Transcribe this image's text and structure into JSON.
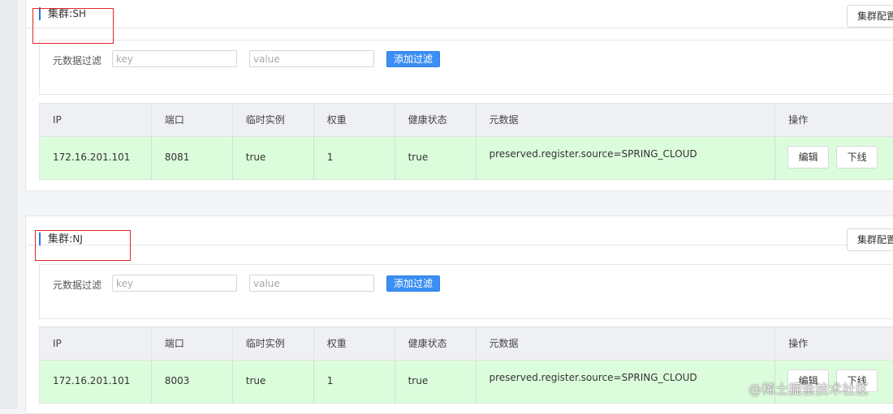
{
  "clusters": [
    {
      "title_prefix": "集群:",
      "name": "SH",
      "config_button": "集群配置",
      "filter": {
        "label": "元数据过滤",
        "key_placeholder": "key",
        "value_placeholder": "value",
        "add_button": "添加过滤"
      },
      "table": {
        "headers": [
          "IP",
          "端口",
          "临时实例",
          "权重",
          "健康状态",
          "元数据",
          "操作"
        ],
        "rows": [
          {
            "ip": "172.16.201.101",
            "port": "8081",
            "ephemeral": "true",
            "weight": "1",
            "healthy": "true",
            "metadata": "preserved.register.source=SPRING_CLOUD",
            "edit": "编辑",
            "offline": "下线"
          }
        ]
      }
    },
    {
      "title_prefix": "集群:",
      "name": "NJ",
      "config_button": "集群配置",
      "filter": {
        "label": "元数据过滤",
        "key_placeholder": "key",
        "value_placeholder": "value",
        "add_button": "添加过滤"
      },
      "table": {
        "headers": [
          "IP",
          "端口",
          "临时实例",
          "权重",
          "健康状态",
          "元数据",
          "操作"
        ],
        "rows": [
          {
            "ip": "172.16.201.101",
            "port": "8003",
            "ephemeral": "true",
            "weight": "1",
            "healthy": "true",
            "metadata": "preserved.register.source=SPRING_CLOUD",
            "edit": "编辑",
            "offline": "下线"
          }
        ]
      }
    }
  ],
  "watermark": "@稀土掘金技术社区",
  "colors": {
    "accent": "#2f74e8",
    "primary_button": "#3b8ff4",
    "healthy_row": "#dcfddb",
    "highlight": "#e0262b"
  }
}
